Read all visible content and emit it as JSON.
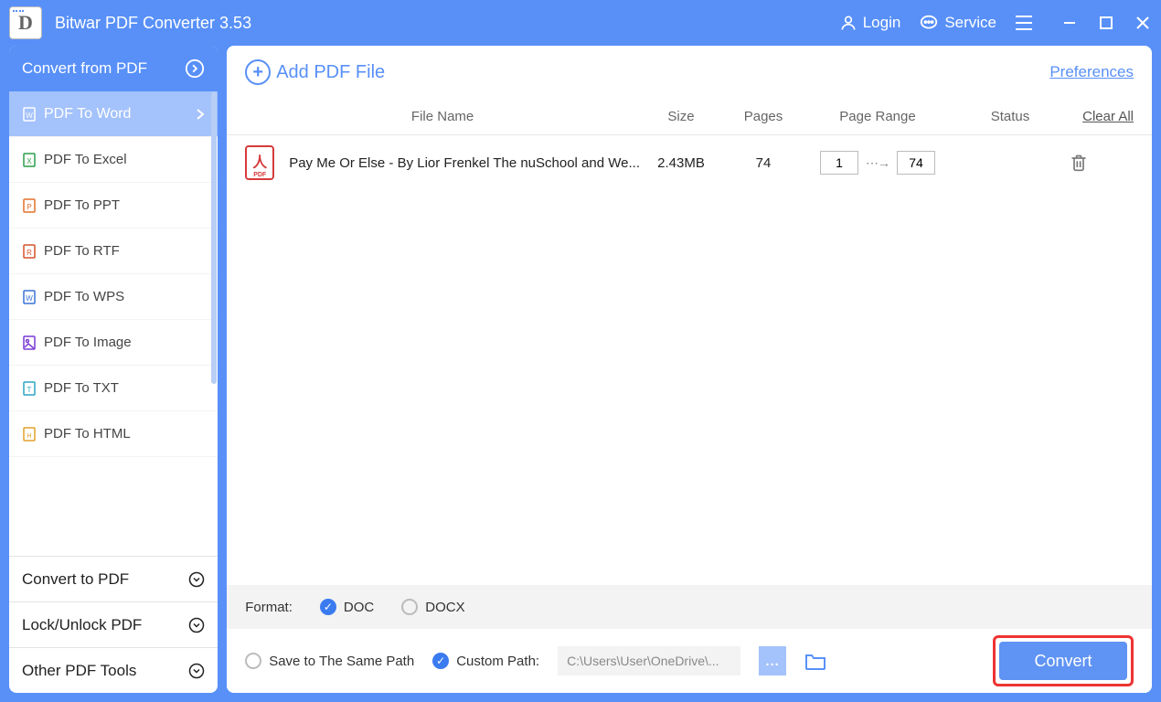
{
  "titlebar": {
    "app_name": "Bitwar PDF Converter 3.53",
    "login": "Login",
    "service": "Service"
  },
  "sidebar": {
    "section_primary": "Convert from PDF",
    "items": [
      {
        "label": "PDF To Word",
        "icon_color": "#fff"
      },
      {
        "label": "PDF To Excel",
        "icon_color": "#2a9d4a"
      },
      {
        "label": "PDF To PPT",
        "icon_color": "#e3702a"
      },
      {
        "label": "PDF To RTF",
        "icon_color": "#d6522a"
      },
      {
        "label": "PDF To WPS",
        "icon_color": "#3a72d6"
      },
      {
        "label": "PDF To Image",
        "icon_color": "#7a3ad6"
      },
      {
        "label": "PDF To TXT",
        "icon_color": "#2aa6c4"
      },
      {
        "label": "PDF To HTML",
        "icon_color": "#e3a02a"
      }
    ],
    "sections_collapsed": [
      "Convert to PDF",
      "Lock/Unlock PDF",
      "Other PDF Tools"
    ]
  },
  "main": {
    "add_file": "Add PDF File",
    "preferences": "Preferences",
    "columns": {
      "name": "File Name",
      "size": "Size",
      "pages": "Pages",
      "range": "Page Range",
      "status": "Status",
      "clear": "Clear All"
    },
    "files": [
      {
        "name": "Pay Me Or Else - By Lior Frenkel The nuSchool and We...",
        "size": "2.43MB",
        "pages": "74",
        "range_from": "1",
        "range_to": "74"
      }
    ],
    "format_label": "Format:",
    "formats": [
      {
        "label": "DOC",
        "checked": true
      },
      {
        "label": "DOCX",
        "checked": false
      }
    ],
    "save_same_path": "Save to The Same Path",
    "custom_path_label": "Custom Path:",
    "custom_path_value": "C:\\Users\\User\\OneDrive\\...",
    "convert": "Convert"
  }
}
